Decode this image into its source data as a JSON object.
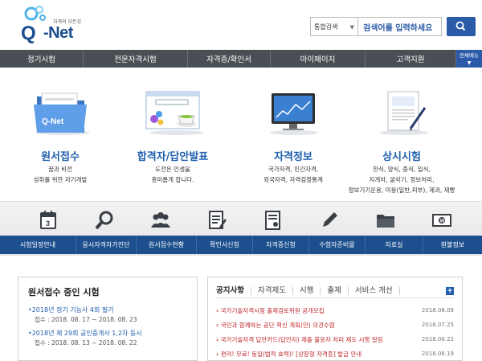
{
  "header": {
    "logo_tagline": "자격의 모든것",
    "logo_q": "Q",
    "logo_name": "-Net",
    "search_scope": "통합검색",
    "search_placeholder": "검색어를 입력하세요"
  },
  "nav": {
    "items": [
      {
        "label": "정기시험"
      },
      {
        "label": "전문자격시험"
      },
      {
        "label": "자격증/확인서"
      },
      {
        "label": "마이페이지"
      },
      {
        "label": "고객지원"
      }
    ],
    "all_menu_label": "전체메뉴"
  },
  "features": [
    {
      "title": "원서접수",
      "line1": "꿈과 비전",
      "line2": "성취를 위한 자기개발",
      "icon": "folder-icon"
    },
    {
      "title": "합격자/답안발표",
      "line1": "도전은 인생을",
      "line2": "흥미롭게 합니다.",
      "icon": "browser-icon"
    },
    {
      "title": "자격정보",
      "line1": "국가자격, 민간자격,",
      "line2": "외국자격, 자격검정통계",
      "icon": "monitor-icon"
    },
    {
      "title": "상시시험",
      "line1": "한식, 양식, 중식, 일식,",
      "line2": "지게차, 굴삭기, 정보처리,",
      "line3": "정보기기운용, 미용(일반,피부), 제과, 제빵",
      "icon": "document-icon"
    }
  ],
  "quick_links": [
    {
      "label": "시험일정안내",
      "icon": "calendar-icon"
    },
    {
      "label": "응시자격자가진단",
      "icon": "magnifier-icon"
    },
    {
      "label": "원서접수현황",
      "icon": "people-icon"
    },
    {
      "label": "확인서신청",
      "icon": "form-icon"
    },
    {
      "label": "자격증신청",
      "icon": "certificate-icon"
    },
    {
      "label": "수험자준비물",
      "icon": "pencil-icon"
    },
    {
      "label": "자료실",
      "icon": "folder-icon"
    },
    {
      "label": "환불정보",
      "icon": "money-icon"
    }
  ],
  "exam_panel": {
    "title": "원서접수 중인 시험",
    "items": [
      {
        "name": "2018년 정기 기능사 4회 필기",
        "period": "접수 : 2018. 08. 17 ~ 2018. 08. 23"
      },
      {
        "name": "2018년 제 29회 공인중개사 1,2차 동시",
        "period": "접수 : 2018. 08. 13 ~ 2018. 08. 22"
      }
    ]
  },
  "notice_panel": {
    "tabs": [
      "공지사항",
      "자격제도",
      "시행",
      "출제",
      "서비스 개선"
    ],
    "plus": "+",
    "items": [
      {
        "title": "국가기술자격시험 출제검토위원 공개모집",
        "date": "2018.08.08"
      },
      {
        "title": "국민과 함께하는 공단 혁신 계획(안) 의견수렴",
        "date": "2018.07.25"
      },
      {
        "title": "국가기술자격 답안카드(답안지) 제출 불응자 처리 제도 시행 알림",
        "date": "2018.06.22"
      },
      {
        "title": "편리! 무료! 동일(법적 효력)! [상장형 자격증] 발급 안내",
        "date": "2018.06.19"
      }
    ]
  },
  "colors": {
    "brand_blue": "#1f5fae",
    "nav_bg": "#4a4f55",
    "quick_bar_bg": "#1d4f8e",
    "notice_red": "#c0262b"
  }
}
